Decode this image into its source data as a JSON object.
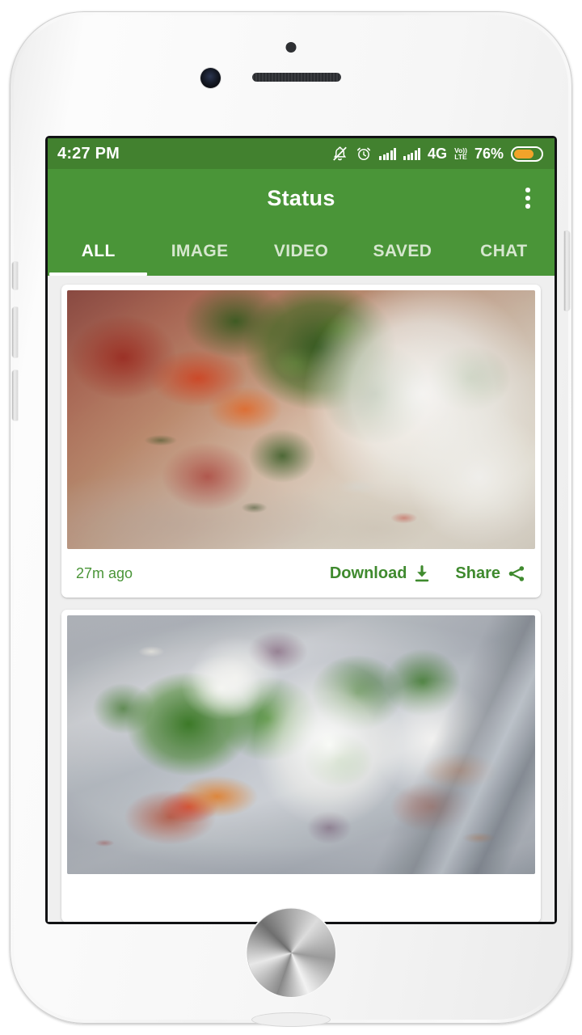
{
  "status_bar": {
    "clock": "4:27 PM",
    "network_type": "4G",
    "volte_top": "Vo))",
    "volte_bottom": "LTE",
    "battery_percent": "76%",
    "battery_level": 76,
    "icons": [
      "notifications-off-icon",
      "alarm-icon",
      "signal-bars-icon",
      "signal-bars-icon",
      "volte-icon",
      "battery-icon"
    ]
  },
  "app_bar": {
    "title": "Status",
    "overflow_icon": "more-vertical-icon"
  },
  "tabs": [
    {
      "label": "ALL",
      "active": true
    },
    {
      "label": "IMAGE",
      "active": false
    },
    {
      "label": "VIDEO",
      "active": false
    },
    {
      "label": "SAVED",
      "active": false
    },
    {
      "label": "CHAT",
      "active": false
    }
  ],
  "feed": {
    "cards": [
      {
        "timestamp": "27m ago",
        "media_kind": "image",
        "media_description": "close-up of Indian chaat with green chutney, red chilli powder and white yogurt on a plate",
        "download_label": "Download",
        "download_icon": "download-icon",
        "share_label": "Share",
        "share_icon": "share-icon"
      },
      {
        "media_kind": "image",
        "media_description": "Indian chaat topped with cilantro, green chutney, shredded onion and yogurt on a steel plate with a spoon"
      }
    ]
  },
  "colors": {
    "app_bar_green": "#4a9538",
    "status_bar_green": "#42812f",
    "accent_green": "#3f8a2e",
    "battery_amber": "#f2a32a",
    "feed_background": "#efefef",
    "card_background": "#ffffff",
    "tab_active_text": "#ffffff",
    "tab_inactive_text": "#d6e7cf"
  },
  "device": {
    "frame_color": "#f4f4f4",
    "home_button": "home-button",
    "buttons": [
      "mute-switch",
      "volume-up-button",
      "volume-down-button",
      "power-button"
    ]
  }
}
